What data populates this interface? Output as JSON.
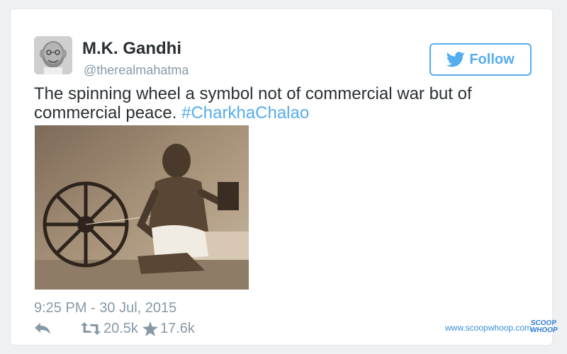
{
  "tweet": {
    "author": {
      "name": "M.K. Gandhi",
      "handle": "@therealmahatma"
    },
    "follow_button": {
      "label": "Follow",
      "icon": "twitter-bird-icon"
    },
    "text": "The spinning wheel a symbol not of commercial war but of commercial peace.",
    "hashtag": "#CharkhaChalao",
    "timestamp": {
      "time": "9:25 PM",
      "separator": "-",
      "date": "30 Jul, 2015"
    },
    "actions": {
      "reply_icon": "reply-icon",
      "retweet_icon": "retweet-icon",
      "retweet_count": "20.5k",
      "favorite_icon": "star-icon",
      "favorite_count": "17.6k"
    }
  },
  "watermark": {
    "url": "www.scoopwhoop.com",
    "logo_line1": "SCOOP",
    "logo_line2": "WHOOP"
  },
  "colors": {
    "accent": "#55acee",
    "text": "#292f33",
    "muted": "#8899a6",
    "watermark": "#3a8fd6"
  }
}
